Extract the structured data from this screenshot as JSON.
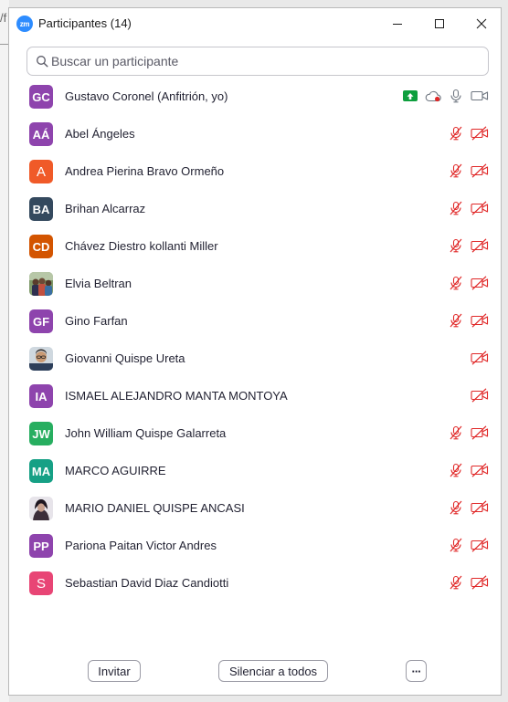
{
  "window": {
    "title": "Participantes (14)",
    "app_logo": "zm"
  },
  "background": {
    "fragment": "/f"
  },
  "search": {
    "placeholder": "Buscar un participante",
    "value": ""
  },
  "colors": {
    "muted_red": "#e02828",
    "icon_gray": "#6e7680",
    "share_green": "#0e9f3e",
    "zoom_blue": "#2d8cff"
  },
  "participants": [
    {
      "initials": "GC",
      "name": "Gustavo Coronel (Anfitrión, yo)",
      "avatar_color": "#8e44ad",
      "host": true,
      "icons": [
        "screen-share-icon",
        "cloud-record-icon",
        "microphone-icon",
        "video-camera-icon"
      ]
    },
    {
      "initials": "AÁ",
      "name": "Abel Ángeles",
      "avatar_color": "#8e44ad",
      "icons": [
        "microphone-muted-icon",
        "video-off-icon"
      ]
    },
    {
      "initials": "A",
      "name": "Andrea Pierina Bravo Ormeño",
      "avatar_color": "#f05a28",
      "icons": [
        "microphone-muted-icon",
        "video-off-icon"
      ]
    },
    {
      "initials": "BA",
      "name": "Brihan Alcarraz",
      "avatar_color": "#34495e",
      "icons": [
        "microphone-muted-icon",
        "video-off-icon"
      ]
    },
    {
      "initials": "CD",
      "name": "Chávez Diestro kollanti Miller",
      "avatar_color": "#d35400",
      "icons": [
        "microphone-muted-icon",
        "video-off-icon"
      ]
    },
    {
      "initials": "",
      "name": "Elvia Beltran",
      "avatar_type": "photo-group",
      "icons": [
        "microphone-muted-icon",
        "video-off-icon"
      ]
    },
    {
      "initials": "GF",
      "name": "Gino Farfan",
      "avatar_color": "#8e44ad",
      "icons": [
        "microphone-muted-icon",
        "video-off-icon"
      ]
    },
    {
      "initials": "",
      "name": "Giovanni Quispe Ureta",
      "avatar_type": "photo-person",
      "icons": [
        "video-off-icon"
      ]
    },
    {
      "initials": "IA",
      "name": "ISMAEL ALEJANDRO MANTA MONTOYA",
      "avatar_color": "#8e44ad",
      "icons": [
        "video-off-icon"
      ]
    },
    {
      "initials": "JW",
      "name": "John William Quispe Galarreta",
      "avatar_color": "#27ae60",
      "icons": [
        "microphone-muted-icon",
        "video-off-icon"
      ]
    },
    {
      "initials": "MA",
      "name": "MARCO AGUIRRE",
      "avatar_color": "#16a085",
      "icons": [
        "microphone-muted-icon",
        "video-off-icon"
      ]
    },
    {
      "initials": "",
      "name": "MARIO DANIEL QUISPE ANCASI",
      "avatar_type": "photo-dark",
      "icons": [
        "microphone-muted-icon",
        "video-off-icon"
      ]
    },
    {
      "initials": "PP",
      "name": "Pariona Paitan Victor Andres",
      "avatar_color": "#8e44ad",
      "icons": [
        "microphone-muted-icon",
        "video-off-icon"
      ]
    },
    {
      "initials": "S",
      "name": "Sebastian David Diaz Candiotti",
      "avatar_color": "#e84575",
      "icons": [
        "microphone-muted-icon",
        "video-off-icon"
      ]
    }
  ],
  "footer": {
    "invite_label": "Invitar",
    "mute_all_label": "Silenciar a todos",
    "more_label": "···"
  }
}
